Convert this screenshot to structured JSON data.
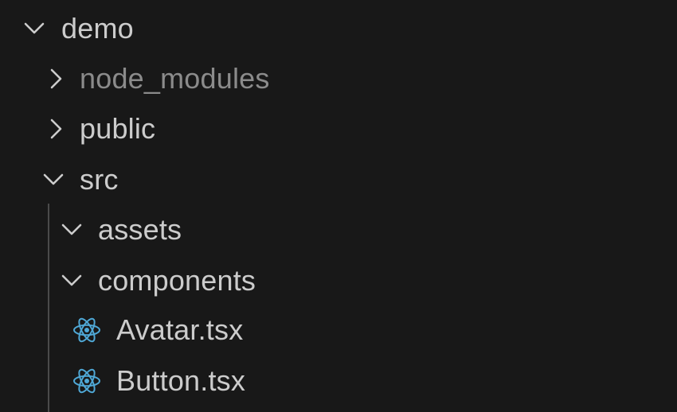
{
  "explorer": {
    "colors": {
      "background": "#181818",
      "text": "#cccccc",
      "ignored_text": "#8b8b8b",
      "react_icon": "#4fa8d6"
    },
    "items": [
      {
        "label": "demo",
        "kind": "folder",
        "expanded": true,
        "depth": 0
      },
      {
        "label": "node_modules",
        "kind": "folder",
        "expanded": false,
        "depth": 1,
        "ignored": true
      },
      {
        "label": "public",
        "kind": "folder",
        "expanded": false,
        "depth": 1
      },
      {
        "label": "src",
        "kind": "folder",
        "expanded": true,
        "depth": 1
      },
      {
        "label": "assets",
        "kind": "folder",
        "expanded": true,
        "depth": 2
      },
      {
        "label": "components",
        "kind": "folder",
        "expanded": true,
        "depth": 2
      },
      {
        "label": "Avatar.tsx",
        "kind": "file",
        "icon": "react-icon",
        "depth": 3
      },
      {
        "label": "Button.tsx",
        "kind": "file",
        "icon": "react-icon",
        "depth": 3
      }
    ]
  }
}
